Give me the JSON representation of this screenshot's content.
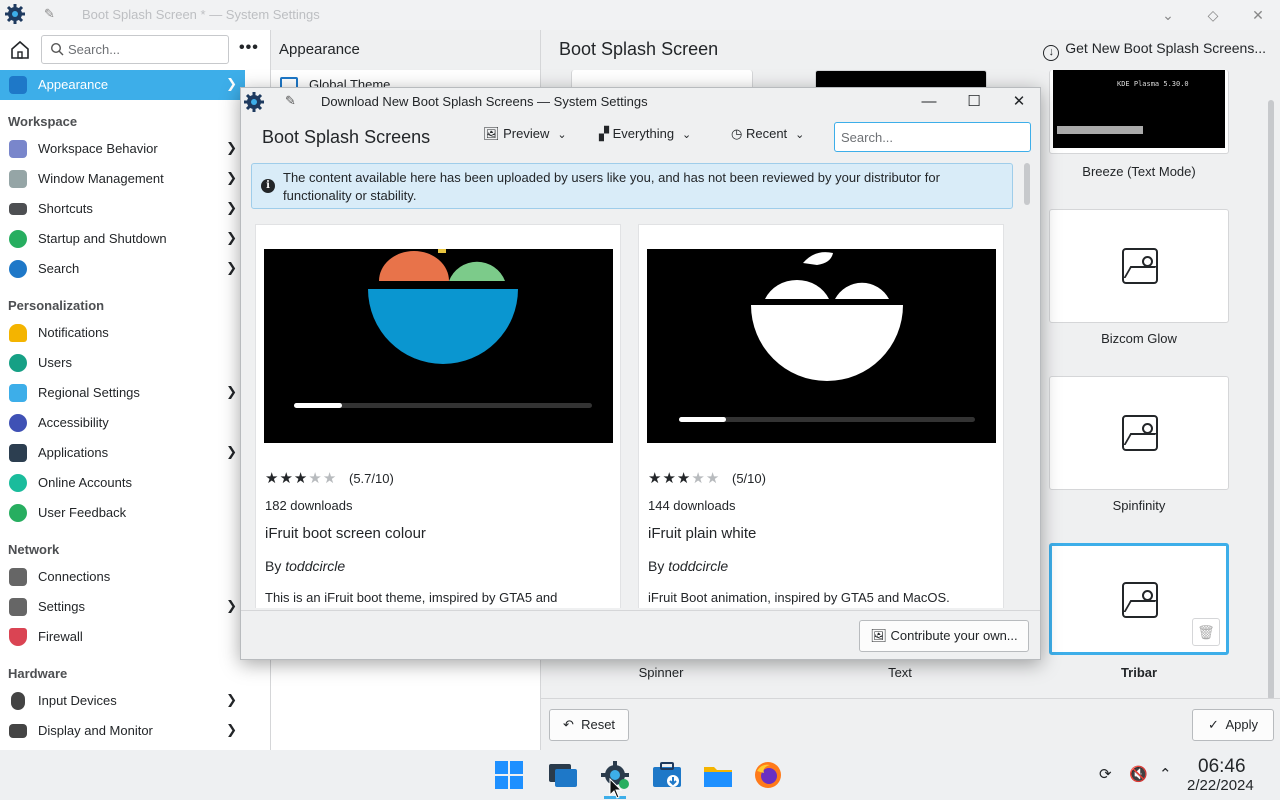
{
  "window": {
    "title": "Boot Splash Screen * — System Settings"
  },
  "sidebar": {
    "search_placeholder": "Search...",
    "items": [
      {
        "label": "Appearance",
        "icon": "appearance-icon",
        "color": "#1e78c8"
      },
      {
        "category": "Workspace"
      },
      {
        "label": "Workspace Behavior",
        "icon": "workspace-behavior-icon",
        "color": "#5c6bc0"
      },
      {
        "label": "Window Management",
        "icon": "window-management-icon",
        "color": "#7f8c8d"
      },
      {
        "label": "Shortcuts",
        "icon": "keyboard-icon",
        "color": "#4d4f52"
      },
      {
        "label": "Startup and Shutdown",
        "icon": "startup-icon",
        "color": "#27ae60"
      },
      {
        "label": "Search",
        "icon": "search-icon",
        "color": "#1e78c8"
      },
      {
        "category": "Personalization"
      },
      {
        "label": "Notifications",
        "icon": "bell-icon",
        "color": "#f4b400"
      },
      {
        "label": "Users",
        "icon": "users-icon",
        "color": "#16a085"
      },
      {
        "label": "Regional Settings",
        "icon": "language-icon",
        "color": "#3daee9"
      },
      {
        "label": "Accessibility",
        "icon": "accessibility-icon",
        "color": "#3f51b5"
      },
      {
        "label": "Applications",
        "icon": "applications-icon",
        "color": "#2c3e50"
      },
      {
        "label": "Online Accounts",
        "icon": "at-icon",
        "color": "#1abc9c"
      },
      {
        "label": "User Feedback",
        "icon": "feedback-icon",
        "color": "#27ae60"
      },
      {
        "category": "Network"
      },
      {
        "label": "Connections",
        "icon": "connections-icon",
        "color": "#555"
      },
      {
        "label": "Settings",
        "icon": "network-settings-icon",
        "color": "#555"
      },
      {
        "label": "Firewall",
        "icon": "firewall-icon",
        "color": "#da4453"
      },
      {
        "category": "Hardware"
      },
      {
        "label": "Input Devices",
        "icon": "mouse-icon",
        "color": "#444"
      },
      {
        "label": "Display and Monitor",
        "icon": "monitor-icon",
        "color": "#444"
      }
    ]
  },
  "col2": {
    "header": "Appearance",
    "first_item": "Global Theme"
  },
  "main": {
    "header": "Boot Splash Screen",
    "get_new": "Get New Boot Splash Screens...",
    "themes": [
      {
        "label": "Breeze (Text Mode)",
        "preview_text": "KDE Plasma 5.30.0"
      },
      {
        "label": "Bizcom Glow"
      },
      {
        "label": "Spinfinity"
      },
      {
        "label": "Spinner"
      },
      {
        "label": "Text"
      },
      {
        "label": "Tribar"
      }
    ],
    "reset_label": "Reset",
    "apply_label": "Apply"
  },
  "dialog": {
    "title": "Download New Boot Splash Screens — System Settings",
    "header": "Boot Splash Screens",
    "preview_label": "Preview",
    "filter_label": "Everything",
    "sort_label": "Recent",
    "search_placeholder": "Search...",
    "info_text": "The content available here has been uploaded by users like you, and has not been reviewed by your distributor for functionality or stability.",
    "items": [
      {
        "name": "iFruit boot screen colour",
        "rating_text": "(5.7/10)",
        "stars": 3,
        "downloads": "182 downloads",
        "by": "By",
        "author": "toddcircle",
        "description": "This is an iFruit boot theme, imspired by GTA5 and",
        "progress": 0.16
      },
      {
        "name": "iFruit plain white",
        "rating_text": "(5/10)",
        "stars": 3,
        "downloads": "144 downloads",
        "by": "By",
        "author": "toddcircle",
        "description": "iFruit Boot animation, inspired by GTA5 and MacOS.",
        "progress": 0.16
      }
    ],
    "contribute_label": "Contribute your own..."
  },
  "taskbar": {
    "apps": [
      "start-menu-icon",
      "task-view-icon",
      "system-settings-icon",
      "discover-icon",
      "file-manager-icon",
      "firefox-icon"
    ],
    "time": "06:46",
    "date": "2/22/2024"
  }
}
